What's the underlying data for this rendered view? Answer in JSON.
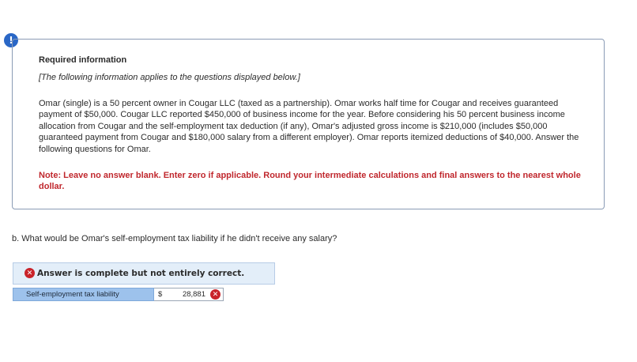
{
  "alert_icon": {
    "glyph": "!",
    "color": "#2a67c6"
  },
  "info": {
    "title": "Required information",
    "subtitle": "[The following information applies to the questions displayed below.]",
    "body": "Omar (single) is a 50 percent owner in Cougar LLC (taxed as a partnership). Omar works half time for Cougar and receives guaranteed payment of $50,000. Cougar LLC reported $450,000 of business income for the year. Before considering his 50 percent business income allocation from Cougar and the self-employment tax deduction (if any), Omar's adjusted gross income is $210,000 (includes $50,000 guaranteed payment from Cougar and $180,000 salary from a different employer). Omar reports itemized deductions of $40,000. Answer the following questions for Omar.",
    "note": "Note: Leave no answer blank. Enter zero if applicable. Round your intermediate calculations and final answers to the nearest whole dollar."
  },
  "question": {
    "text": "b. What would be Omar's self-employment tax liability if he didn't receive any salary?"
  },
  "result": {
    "banner": "Answer is complete but not entirely correct.",
    "status_color": "#c9232a",
    "rows": [
      {
        "label": "Self-employment tax liability",
        "currency": "$",
        "value": "28,881",
        "status": "incorrect"
      }
    ]
  }
}
